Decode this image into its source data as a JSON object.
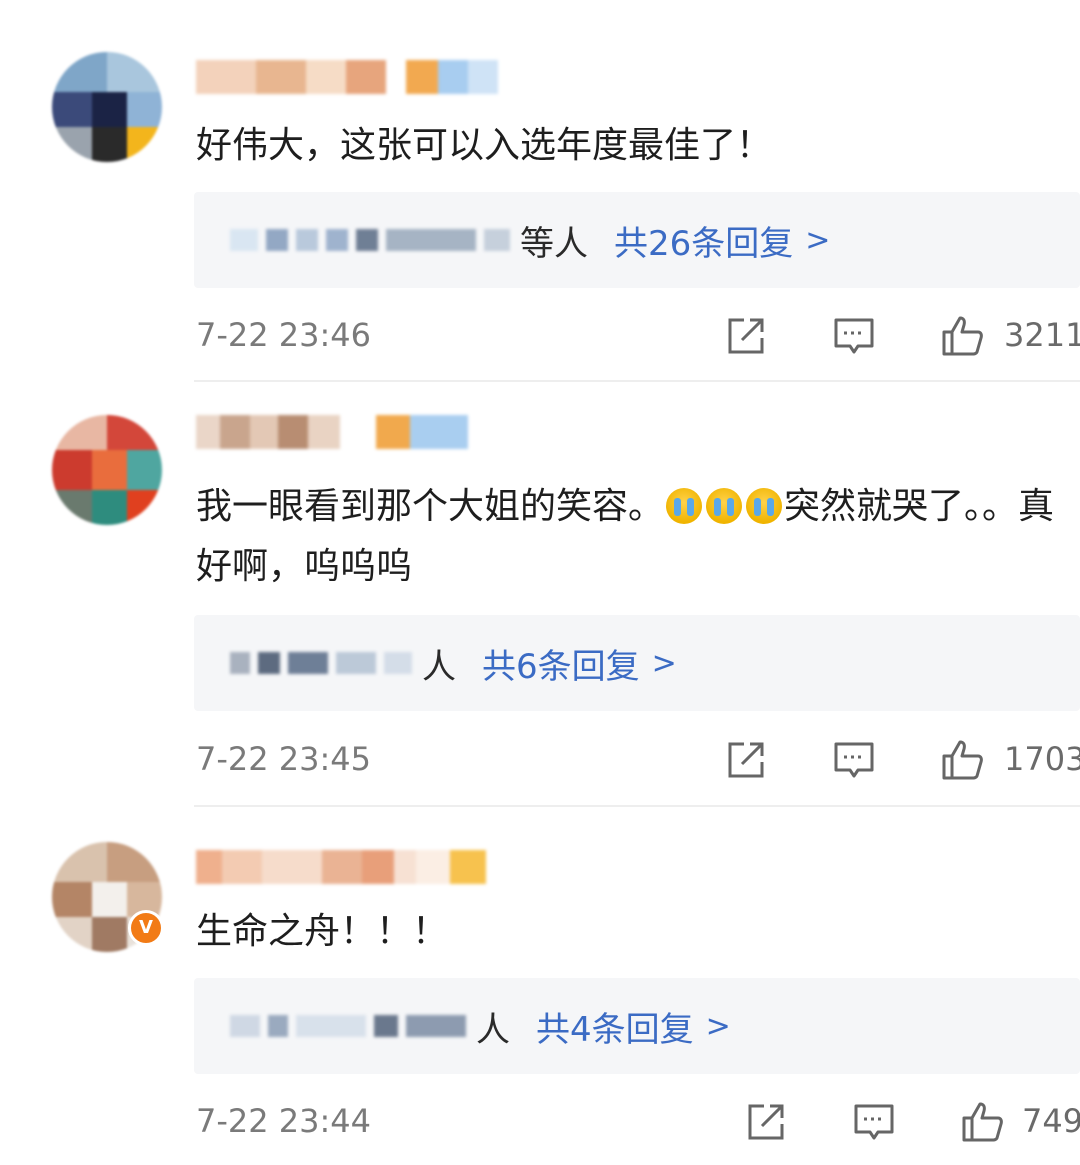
{
  "comments": [
    {
      "text": "好伟大，这张可以入选年度最佳了！",
      "reply_suffix": "等人",
      "reply_link": "共26条回复",
      "reply_chevron": ">",
      "timestamp": "7-22 23:46",
      "likes": "3211",
      "verified": false
    },
    {
      "text_part1": "我一眼看到那个大姐的笑容。",
      "text_part2": "突然就哭了。。真好啊，呜呜呜",
      "emoji_icon": "crying-face-emoji",
      "reply_suffix": "人",
      "reply_link": "共6条回复",
      "reply_chevron": ">",
      "timestamp": "7-22 23:45",
      "likes": "1703",
      "verified": false
    },
    {
      "text": "生命之舟！！！",
      "reply_suffix": "人",
      "reply_link": "共4条回复",
      "reply_chevron": ">",
      "timestamp": "7-22 23:44",
      "likes": "749",
      "verified": true,
      "verified_badge": "V"
    }
  ],
  "icons": {
    "share": "share-icon",
    "comment": "comment-icon",
    "like": "thumbs-up-icon",
    "verified": "verified-badge-icon"
  },
  "colors": {
    "link": "#3b6bc4",
    "muted": "#7a7a7a",
    "reply_bg": "#f5f6f8",
    "verified_badge": "#f27b16"
  }
}
